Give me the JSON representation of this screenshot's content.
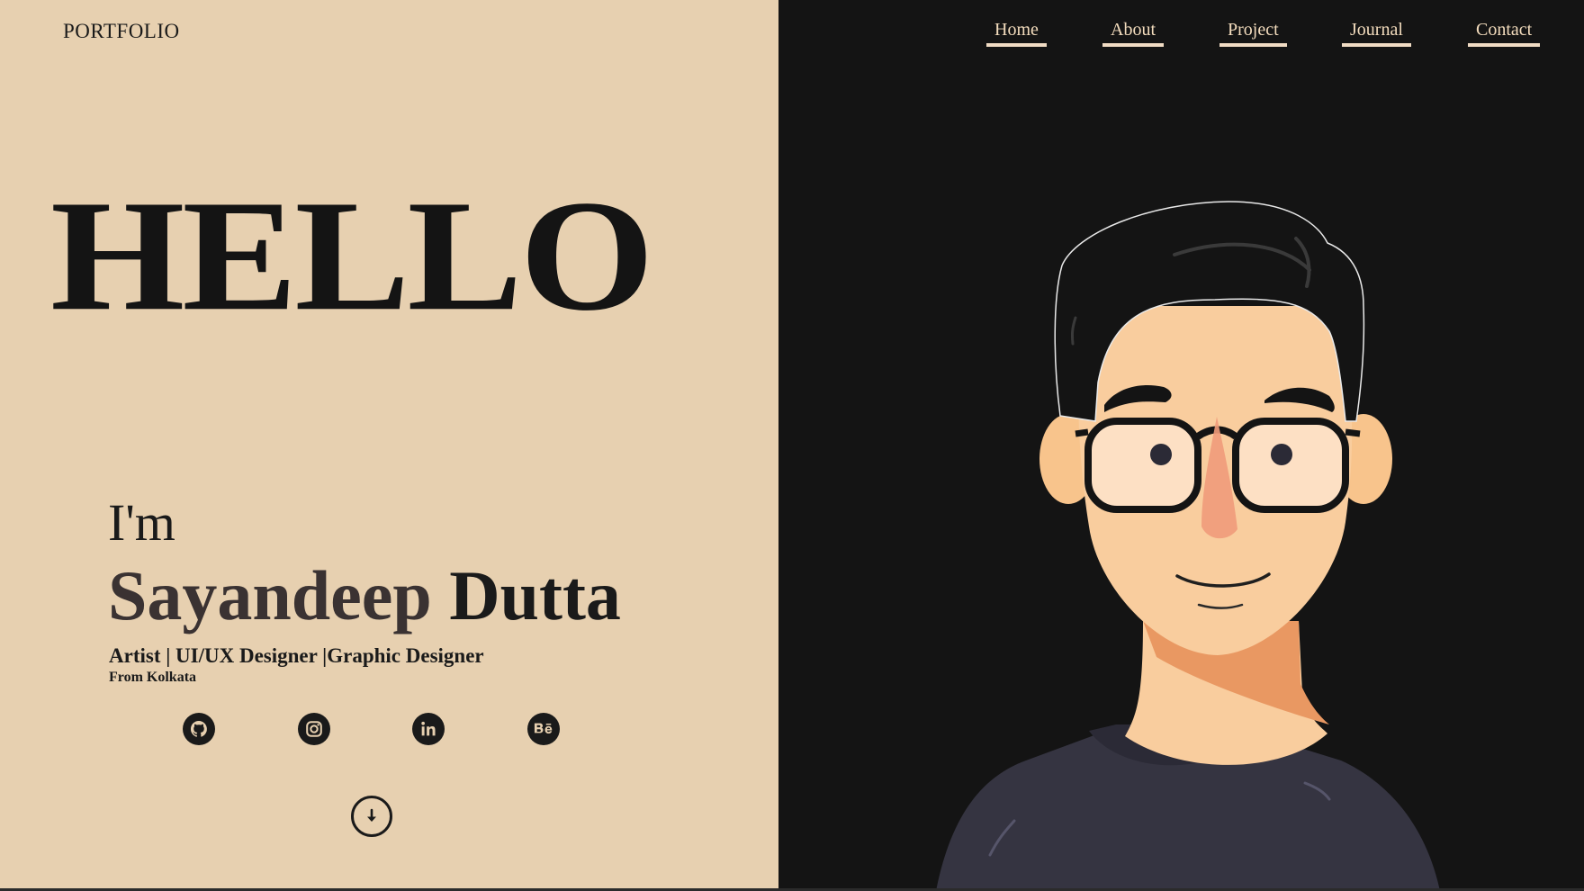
{
  "header": {
    "brand": "PORTFOLIO",
    "nav": [
      "Home",
      "About",
      "Project",
      "Journal",
      "Contact"
    ]
  },
  "hero": {
    "greeting": "HELLO",
    "intro": "I'm",
    "first_name": "Sayandeep",
    "last_name": "Dutta",
    "roles": "Artist | UI/UX Designer |Graphic Designer",
    "location": "From Kolkata"
  },
  "social_icons": [
    "github-icon",
    "instagram-icon",
    "linkedin-icon",
    "behance-icon"
  ],
  "scroll_icon": "arrow-down-icon",
  "colors": {
    "left_background": "#e7d0b0",
    "right_background": "#141414",
    "text_dark": "#1a1a1a",
    "nav_text": "#f3dcbd",
    "skin": "#f9cd9e",
    "shirt": "#353441"
  }
}
